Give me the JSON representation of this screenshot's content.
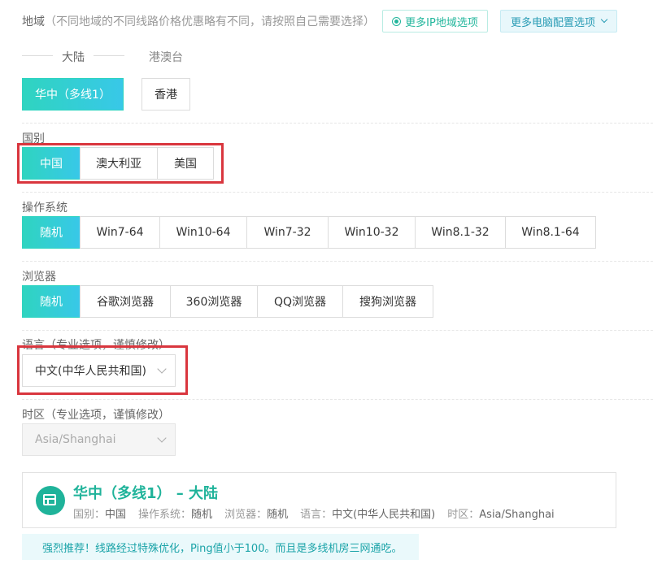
{
  "region": {
    "label": "地域",
    "hint": "（不同地域的不同线路价格优惠略有不同，请按照自己需要选择）",
    "more_ip_button": "更多IP地域选项",
    "more_config_button": "更多电脑配置选项",
    "tabs": [
      "大陆",
      "港澳台"
    ],
    "options": [
      "华中（多线1）",
      "香港"
    ]
  },
  "country": {
    "label": "国别",
    "options": [
      "中国",
      "澳大利亚",
      "美国"
    ]
  },
  "os": {
    "label": "操作系统",
    "options": [
      "随机",
      "Win7-64",
      "Win10-64",
      "Win7-32",
      "Win10-32",
      "Win8.1-32",
      "Win8.1-64"
    ]
  },
  "browser": {
    "label": "浏览器",
    "options": [
      "随机",
      "谷歌浏览器",
      "360浏览器",
      "QQ浏览器",
      "搜狗浏览器"
    ]
  },
  "language": {
    "label": "语言（专业选项，谨慎修改）",
    "value": "中文(中华人民共和国)"
  },
  "timezone": {
    "label": "时区（专业选项，谨慎修改）",
    "value": "Asia/Shanghai"
  },
  "summary": {
    "title": "华中（多线1） – 大陆",
    "country_label": "国别：",
    "country_value": "中国",
    "os_label": "操作系统：",
    "os_value": "随机",
    "browser_label": "浏览器：",
    "browser_value": "随机",
    "language_label": "语言：",
    "language_value": "中文(中华人民共和国)",
    "timezone_label": "时区：",
    "timezone_value": "Asia/Shanghai"
  },
  "tip": "强烈推荐！线路经过特殊优化，Ping值小于100。而且是多线机房三网通吃。",
  "colors": {
    "accent": "#2fd4c0",
    "accent_end": "#38c8e8",
    "title_green": "#1fb39a",
    "annotation_red": "#d9363e"
  },
  "icons": [
    "eye-icon",
    "chevron-down-icon",
    "server-icon"
  ]
}
